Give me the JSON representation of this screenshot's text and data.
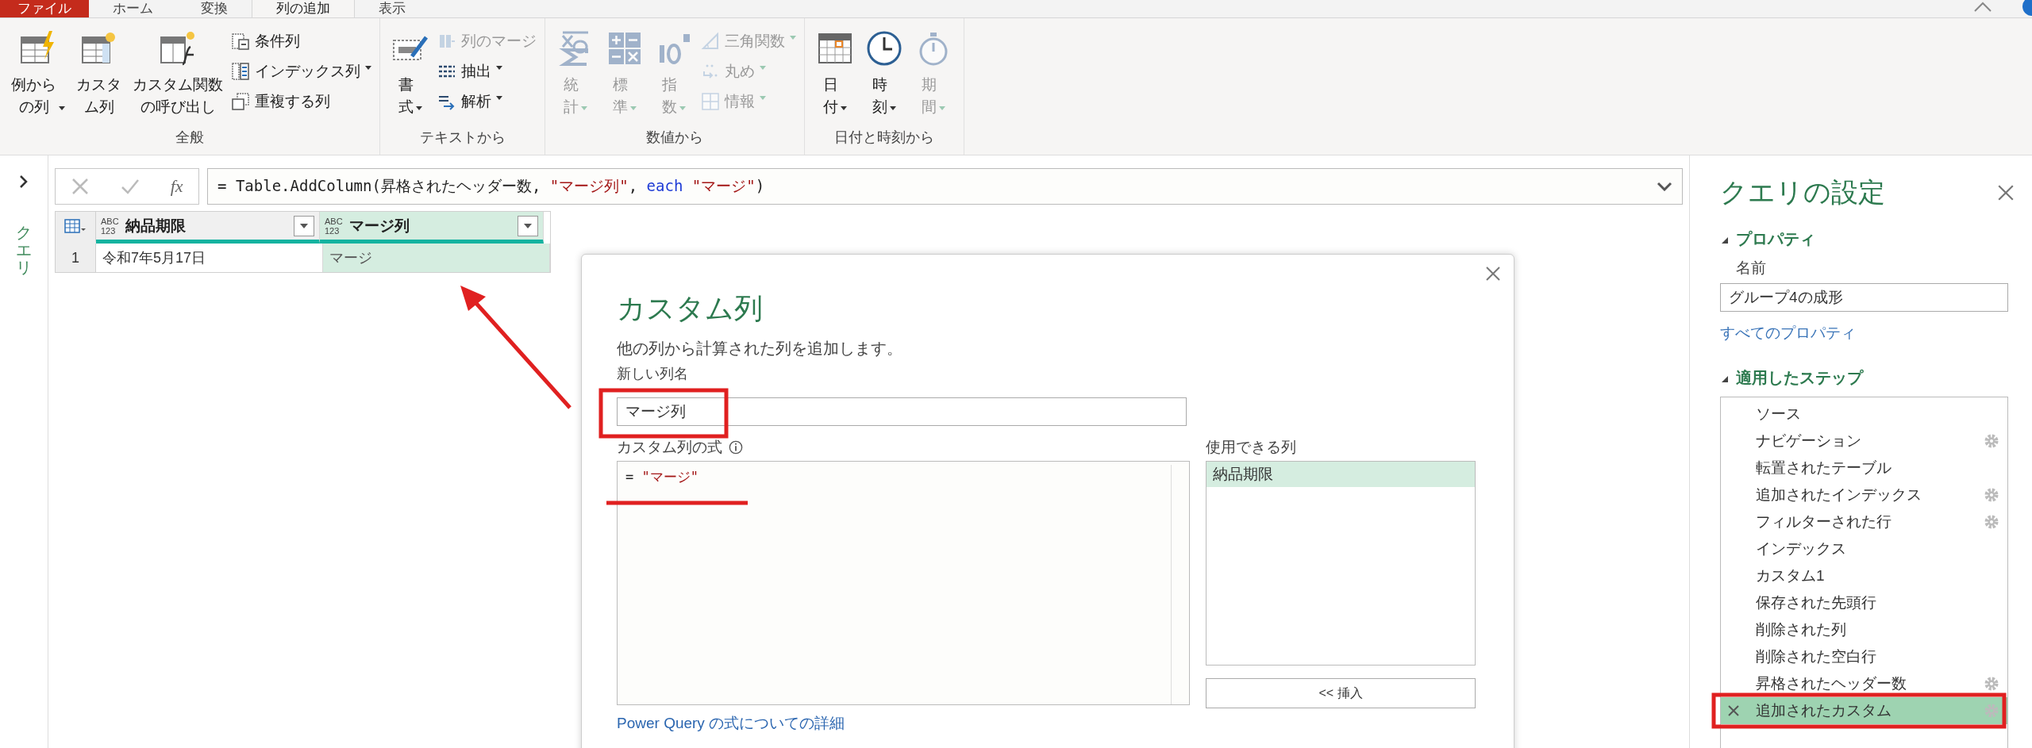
{
  "tabs": [
    {
      "label": "ファイル",
      "kind": "file",
      "selected": false
    },
    {
      "label": "ホーム",
      "kind": "normal",
      "selected": false
    },
    {
      "label": "変換",
      "kind": "normal",
      "selected": false
    },
    {
      "label": "列の追加",
      "kind": "normal",
      "selected": true
    },
    {
      "label": "表示",
      "kind": "normal",
      "selected": false
    }
  ],
  "ribbon": {
    "groups": [
      {
        "label": "全般",
        "buttons": [
          {
            "kind": "large",
            "label_lines": [
              "例から",
              "の列"
            ],
            "dropdown": true,
            "disabled": false
          },
          {
            "kind": "large",
            "label_lines": [
              "カスタ",
              "ム列"
            ],
            "dropdown": false,
            "disabled": false
          },
          {
            "kind": "large",
            "label_lines": [
              "カスタム関数",
              "の呼び出し"
            ],
            "dropdown": false,
            "disabled": false
          },
          {
            "kind": "small",
            "label_lines": [
              "条件列"
            ],
            "dropdown": false,
            "disabled": false
          },
          {
            "kind": "small",
            "label_lines": [
              "インデックス列"
            ],
            "dropdown": true,
            "disabled": false
          },
          {
            "kind": "small",
            "label_lines": [
              "重複する列"
            ],
            "dropdown": false,
            "disabled": false
          }
        ]
      },
      {
        "label": "テキストから",
        "buttons": [
          {
            "kind": "large",
            "label_lines": [
              "書",
              "式"
            ],
            "dropdown": true,
            "disabled": false
          },
          {
            "kind": "small",
            "label_lines": [
              "列のマージ"
            ],
            "dropdown": false,
            "disabled": true
          },
          {
            "kind": "small",
            "label_lines": [
              "抽出"
            ],
            "dropdown": true,
            "disabled": false
          },
          {
            "kind": "small",
            "label_lines": [
              "解析"
            ],
            "dropdown": true,
            "disabled": false
          }
        ]
      },
      {
        "label": "数値から",
        "buttons": [
          {
            "kind": "large",
            "label_lines": [
              "統",
              "計"
            ],
            "dropdown": true,
            "disabled": true
          },
          {
            "kind": "large",
            "label_lines": [
              "標",
              "準"
            ],
            "dropdown": true,
            "disabled": true
          },
          {
            "kind": "large",
            "label_lines": [
              "指",
              "数"
            ],
            "dropdown": true,
            "disabled": true
          },
          {
            "kind": "small",
            "label_lines": [
              "三角関数"
            ],
            "dropdown": true,
            "disabled": true
          },
          {
            "kind": "small",
            "label_lines": [
              "丸め"
            ],
            "dropdown": true,
            "disabled": true
          },
          {
            "kind": "small",
            "label_lines": [
              "情報"
            ],
            "dropdown": true,
            "disabled": true
          }
        ]
      },
      {
        "label": "日付と時刻から",
        "buttons": [
          {
            "kind": "large",
            "label_lines": [
              "日",
              "付"
            ],
            "dropdown": true,
            "disabled": false
          },
          {
            "kind": "large",
            "label_lines": [
              "時",
              "刻"
            ],
            "dropdown": true,
            "disabled": false
          },
          {
            "kind": "large",
            "label_lines": [
              "期",
              "間"
            ],
            "dropdown": true,
            "disabled": true
          }
        ]
      }
    ]
  },
  "queries_pane": {
    "label": "クエリ",
    "expanded": false
  },
  "formula_bar": {
    "function_label": "fx",
    "parts": [
      {
        "kind": "plain",
        "text": "= Table.AddColumn(昇格されたヘッダー数, "
      },
      {
        "kind": "string",
        "text": "\"マージ列\""
      },
      {
        "kind": "plain",
        "text": ", "
      },
      {
        "kind": "keyword",
        "text": "each "
      },
      {
        "kind": "string",
        "text": "\"マージ\""
      },
      {
        "kind": "plain",
        "text": ")"
      }
    ]
  },
  "table": {
    "columns": [
      {
        "type_label": "ABC\n123",
        "name": "納品期限",
        "selected": false
      },
      {
        "type_label": "ABC\n123",
        "name": "マージ列",
        "selected": true
      }
    ],
    "rows": [
      {
        "number": "1",
        "cells": [
          "令和7年5月17日",
          "マージ"
        ]
      }
    ]
  },
  "dialog": {
    "title": "カスタム列",
    "description": "他の列から計算された列を追加します。",
    "name_label": "新しい列名",
    "name_value": "マージ列",
    "formula_label": "カスタム列の式",
    "formula_parts": [
      {
        "kind": "plain",
        "text": "= "
      },
      {
        "kind": "string",
        "text": "\"マージ\""
      }
    ],
    "available_label": "使用できる列",
    "available_columns": [
      {
        "label": "納品期限",
        "selected": true
      }
    ],
    "insert_button": "<< 挿入",
    "help_link": "Power Query の式についての詳細"
  },
  "settings": {
    "title": "クエリの設定",
    "properties": {
      "heading": "プロパティ",
      "expanded": true,
      "name_label": "名前",
      "name_value": "グループ4の成形",
      "all_link": "すべてのプロパティ"
    },
    "steps": {
      "heading": "適用したステップ",
      "expanded": true,
      "items": [
        {
          "label": "ソース",
          "settings": false,
          "selected": false
        },
        {
          "label": "ナビゲーション",
          "settings": true,
          "selected": false
        },
        {
          "label": "転置されたテーブル",
          "settings": false,
          "selected": false
        },
        {
          "label": "追加されたインデックス",
          "settings": true,
          "selected": false
        },
        {
          "label": "フィルターされた行",
          "settings": true,
          "selected": false
        },
        {
          "label": "インデックス",
          "settings": false,
          "selected": false
        },
        {
          "label": "カスタム1",
          "settings": false,
          "selected": false
        },
        {
          "label": "保存された先頭行",
          "settings": false,
          "selected": false
        },
        {
          "label": "削除された列",
          "settings": false,
          "selected": false
        },
        {
          "label": "削除された空白行",
          "settings": false,
          "selected": false
        },
        {
          "label": "昇格されたヘッダー数",
          "settings": true,
          "selected": false
        },
        {
          "label": "追加されたカスタム",
          "settings": true,
          "selected": true
        }
      ]
    }
  }
}
